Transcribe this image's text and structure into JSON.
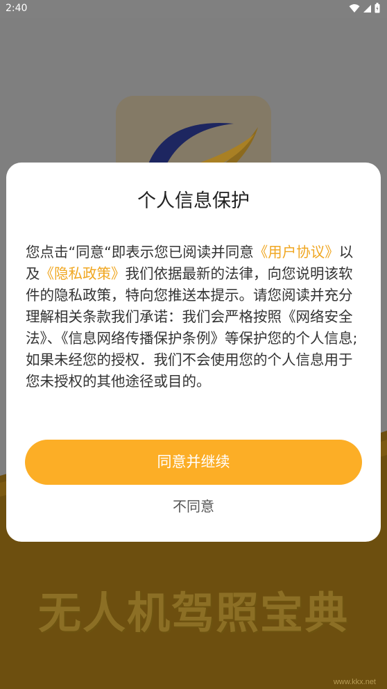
{
  "status_bar": {
    "time": "2:40",
    "icons": [
      "wifi-icon",
      "cell-signal-icon",
      "battery-icon"
    ]
  },
  "splash": {
    "app_name": "无人机驾照宝典",
    "watermark": "www.kkx.net"
  },
  "dialog": {
    "title": "个人信息保护",
    "body_segments": {
      "intro": "您点击“同意“即表示您已阅读并同意",
      "user_agreement_link": "《用户协议》",
      "and_text": "以及",
      "privacy_policy_link": "《隐私政策》",
      "rest": "我们依据最新的法律，向您说明该软件的隐私政策，特向您推送本提示。请您阅读并充分理解相关条款我们承诺：我们会严格按照《网络安全法》、《信息网络传播保护条例》等保护您的个人信息;如果未经您的授权．我们不会使用您的个人信息用于您未授权的其他途径或目的。"
    },
    "agree_button": "同意并继续",
    "disagree_button": "不同意"
  },
  "colors": {
    "accent": "#fcae26",
    "link": "#f0a722",
    "overlay": "#7f7f7f",
    "splash_bottom": "#6e5010"
  }
}
